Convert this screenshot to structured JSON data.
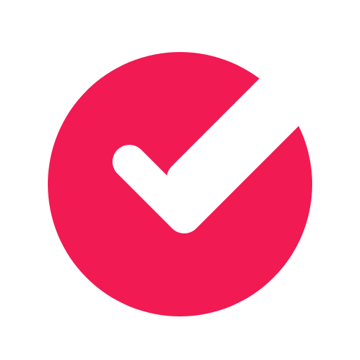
{
  "app": {
    "icon_name": "checkmark-circle-icon",
    "colors": {
      "background": "#ffffff",
      "accent": "#f21a52",
      "check": "#ffffff"
    }
  }
}
